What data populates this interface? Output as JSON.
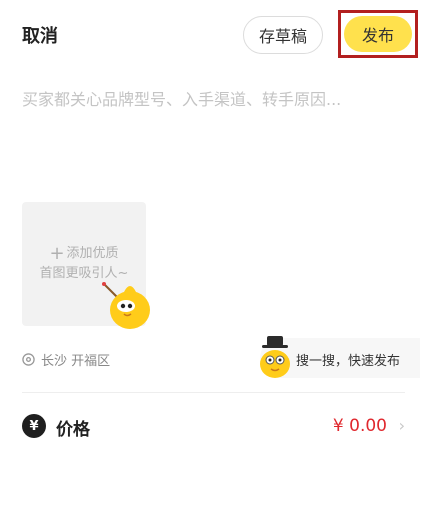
{
  "header": {
    "cancel_label": "取消",
    "draft_label": "存草稿",
    "publish_label": "发布"
  },
  "description": {
    "placeholder": "买家都关心品牌型号、入手渠道、转手原因..."
  },
  "upload": {
    "line1": "添加优质",
    "line2": "首图更吸引人~"
  },
  "location": {
    "text": "长沙 开福区"
  },
  "quick_publish": {
    "text": "搜一搜，快速发布"
  },
  "price": {
    "label": "价格",
    "value": "¥ 0.00",
    "icon_glyph": "¥"
  },
  "colors": {
    "accent_yellow": "#ffe14d",
    "highlight_red": "#b21f1f",
    "price_red": "#e0282e"
  }
}
